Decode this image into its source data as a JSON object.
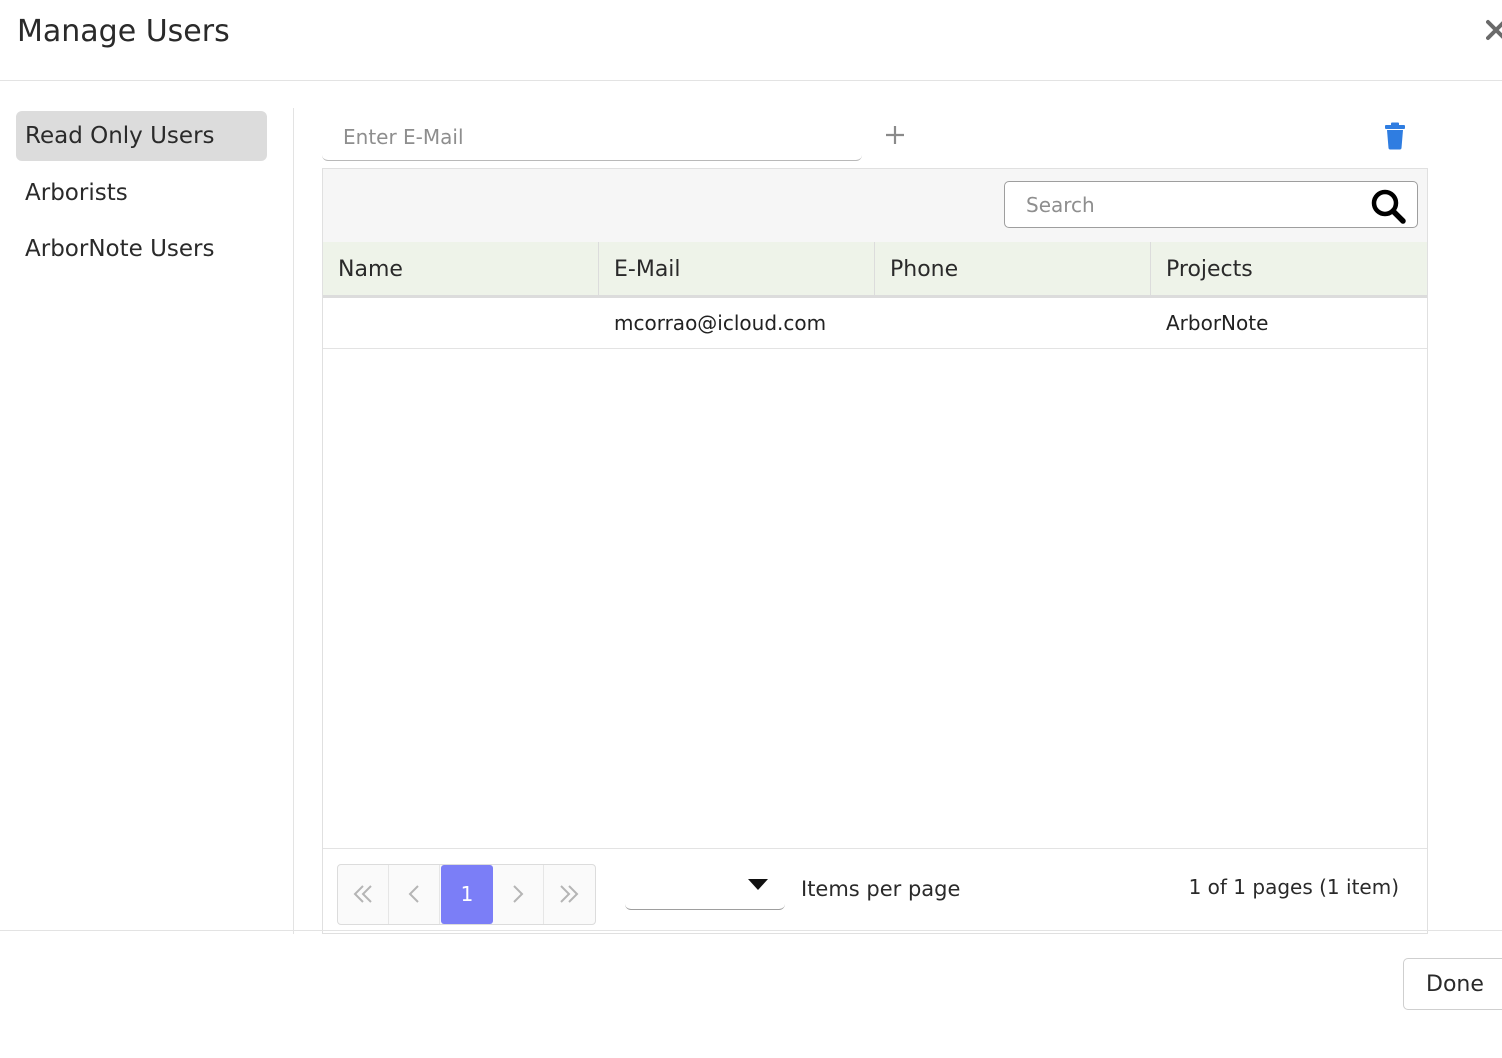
{
  "dialog": {
    "title": "Manage Users",
    "close_icon": "close-icon"
  },
  "sidebar": {
    "items": [
      {
        "label": "Read Only Users",
        "active": true
      },
      {
        "label": "Arborists",
        "active": false
      },
      {
        "label": "ArborNote Users",
        "active": false
      }
    ]
  },
  "toolbar": {
    "email_placeholder": "Enter E-Mail",
    "email_value": "",
    "add_icon": "plus-icon",
    "delete_icon": "trash-icon",
    "delete_color": "#2f7de1"
  },
  "grid": {
    "search_placeholder": "Search",
    "search_icon": "search-icon",
    "header_bg": "#eef3e9",
    "columns": [
      "Name",
      "E-Mail",
      "Phone",
      "Projects"
    ],
    "rows": [
      {
        "name": "",
        "email": "mcorrao@icloud.com",
        "phone": "",
        "projects": "ArborNote"
      }
    ]
  },
  "pager": {
    "current_page": "1",
    "accent": "#7b7ef7",
    "page_size_value": "",
    "items_per_page_label": "Items per page",
    "page_info": "1 of 1 pages (1 item)"
  },
  "footer": {
    "done_label": "Done"
  }
}
